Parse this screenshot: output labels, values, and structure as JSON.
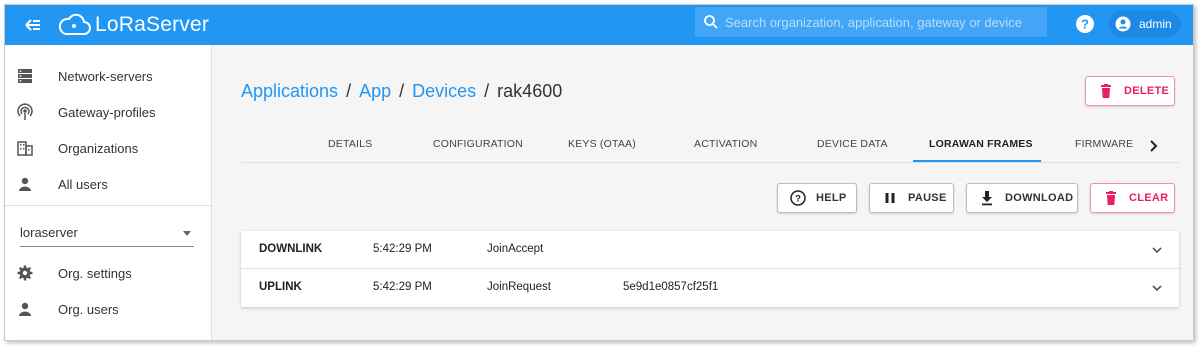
{
  "app": {
    "brand": "LoRaServer",
    "search_placeholder": "Search organization, application, gateway or device",
    "user": "admin",
    "colors": {
      "primary": "#2196f3",
      "danger": "#e91e63"
    }
  },
  "sidebar": {
    "items": [
      {
        "label": "Network-servers",
        "icon": "server-icon"
      },
      {
        "label": "Gateway-profiles",
        "icon": "broadcast-icon"
      },
      {
        "label": "Organizations",
        "icon": "building-icon"
      },
      {
        "label": "All users",
        "icon": "person-icon"
      }
    ],
    "organization": "loraserver",
    "org_items": [
      {
        "label": "Org. settings",
        "icon": "gear-icon"
      },
      {
        "label": "Org. users",
        "icon": "person-icon"
      }
    ]
  },
  "breadcrumb": {
    "applications": "Applications",
    "app": "App",
    "devices": "Devices",
    "device": "rak4600",
    "separator": "/"
  },
  "actions": {
    "delete": "DELETE",
    "help": "HELP",
    "pause": "PAUSE",
    "download": "DOWNLOAD",
    "clear": "CLEAR"
  },
  "tabs": [
    {
      "label": "DETAILS"
    },
    {
      "label": "CONFIGURATION"
    },
    {
      "label": "KEYS (OTAA)"
    },
    {
      "label": "ACTIVATION"
    },
    {
      "label": "DEVICE DATA"
    },
    {
      "label": "LORAWAN FRAMES",
      "active": true
    },
    {
      "label": "FIRMWARE"
    }
  ],
  "frames": [
    {
      "direction": "DOWNLINK",
      "time": "5:42:29 PM",
      "type": "JoinAccept",
      "dev_eui": ""
    },
    {
      "direction": "UPLINK",
      "time": "5:42:29 PM",
      "type": "JoinRequest",
      "dev_eui": "5e9d1e0857cf25f1"
    }
  ]
}
